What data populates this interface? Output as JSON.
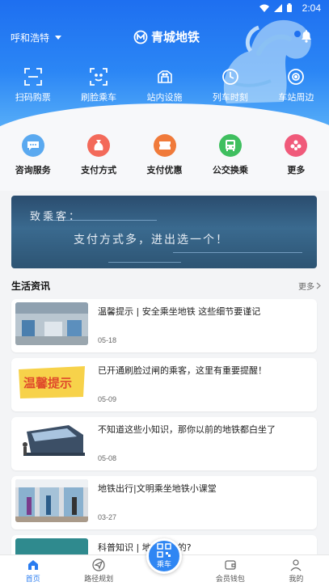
{
  "status_bar": {
    "time": "2:04"
  },
  "header": {
    "city": "呼和浩特",
    "brand": "青城地铁"
  },
  "quick_actions": [
    {
      "label": "扫码购票",
      "icon": "scan-icon"
    },
    {
      "label": "刷脸乘车",
      "icon": "face-scan-icon"
    },
    {
      "label": "站内设施",
      "icon": "facilities-icon"
    },
    {
      "label": "列车时刻",
      "icon": "clock-icon"
    },
    {
      "label": "车站周边",
      "icon": "nearby-icon"
    }
  ],
  "services": [
    {
      "label": "咨询服务",
      "icon": "chat-icon",
      "color": "#5aa9f0"
    },
    {
      "label": "支付方式",
      "icon": "money-bag-icon",
      "color": "#f36a5a"
    },
    {
      "label": "支付优惠",
      "icon": "ticket-icon",
      "color": "#f07a3a"
    },
    {
      "label": "公交换乘",
      "icon": "bus-icon",
      "color": "#3fbf5f"
    },
    {
      "label": "更多",
      "icon": "more-icon",
      "color": "#f05a7a"
    }
  ],
  "banner": {
    "line1": "致乘客：",
    "line2": "支付方式多，进出选一个！"
  },
  "news": {
    "title": "生活资讯",
    "more": "更多",
    "items": [
      {
        "title": "温馨提示 | 安全乘坐地铁 这些细节要谨记",
        "date": "05-18"
      },
      {
        "title": "已开通刷脸过闸的乘客，这里有重要提醒！",
        "date": "05-09"
      },
      {
        "title": "不知道这些小知识，那你以前的地铁都白坐了",
        "date": "05-08"
      },
      {
        "title": "地铁出行|文明乘坐地铁小课堂",
        "date": "03-27"
      },
      {
        "title": "科普知识 | 地铁车头的?",
        "date": ""
      }
    ],
    "thumb2_text": "温馨提示"
  },
  "tabbar": {
    "items": [
      {
        "label": "首页",
        "icon": "home-icon"
      },
      {
        "label": "路径规划",
        "icon": "navigation-icon"
      },
      {
        "label": "",
        "icon": ""
      },
      {
        "label": "会员钱包",
        "icon": "wallet-icon"
      },
      {
        "label": "我的",
        "icon": "user-icon"
      }
    ],
    "ride_label": "乘车"
  }
}
